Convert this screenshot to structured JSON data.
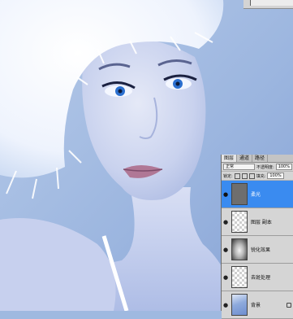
{
  "colors": {
    "background_blue": "#9fb9e0",
    "fur_white": "#f4f8ff",
    "skin": "#cfd6ee",
    "lips": "#b07896",
    "eye_blue": "#2b6fcf",
    "panel_bg": "#d5d5d5",
    "selected_layer": "#3a8bf0"
  },
  "layers_panel": {
    "tabs": [
      "图层",
      "通道",
      "路径"
    ],
    "blend_mode": "正常",
    "opacity_label": "不透明度:",
    "opacity_value": "100%",
    "lock_label": "锁定:",
    "fill_label": "填充:",
    "fill_value": "100%",
    "layers": [
      {
        "name": "柔光",
        "thumb": "fill-grey",
        "selected": true,
        "icon": "eye-icon"
      },
      {
        "name": "图层 副本",
        "thumb": "checker",
        "selected": false,
        "icon": "eye-icon"
      },
      {
        "name": "锐化效果",
        "thumb": "smoke",
        "selected": false,
        "icon": "eye-icon"
      },
      {
        "name": "去斑处理",
        "thumb": "checker",
        "selected": false,
        "icon": "eye-icon"
      },
      {
        "name": "背景",
        "thumb": "photo",
        "selected": false,
        "icon": "eye-icon",
        "locked": true
      }
    ]
  }
}
